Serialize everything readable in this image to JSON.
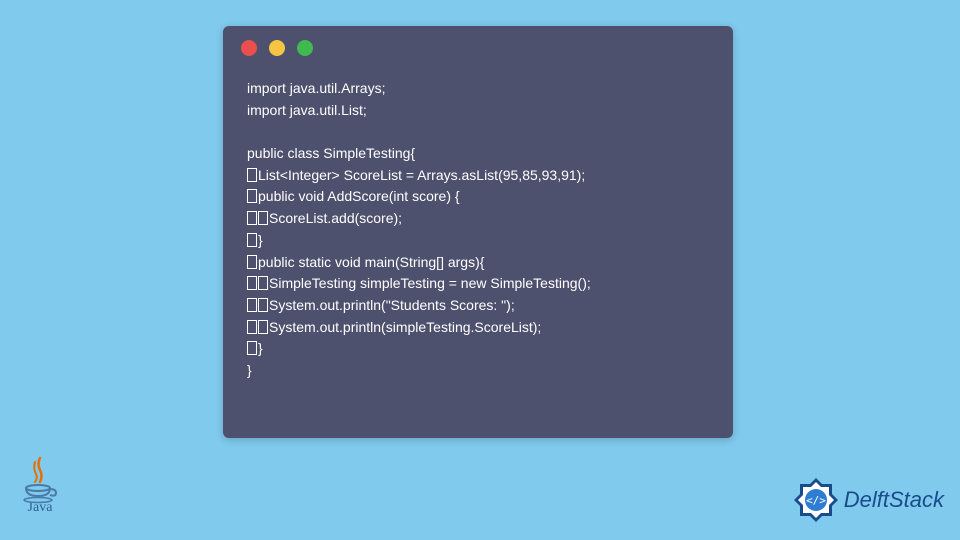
{
  "code": {
    "line1": "import java.util.Arrays;",
    "line2": "import java.util.List;",
    "line3": "",
    "line4": "public class SimpleTesting{",
    "line5_indent1": "List<Integer> ScoreList = Arrays.asList(95,85,93,91);",
    "line6_indent1": "public void AddScore(int score) {",
    "line7_indent2": "ScoreList.add(score);",
    "line8_indent1": "}",
    "line9_indent1": "public static void main(String[] args){",
    "line10_indent2": "SimpleTesting simpleTesting = new SimpleTesting();",
    "line11_indent2": "System.out.println(\"Students Scores: \");",
    "line12_indent2": "System.out.println(simpleTesting.ScoreList);",
    "line13_indent1": "}",
    "line14": "}"
  },
  "logos": {
    "java_text": "Java",
    "delft_text": "DelftStack"
  }
}
